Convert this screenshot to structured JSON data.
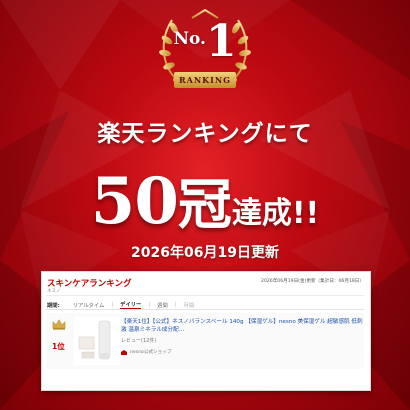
{
  "badge": {
    "no_prefix": "No.",
    "no_number": "1",
    "ribbon": "RANKING"
  },
  "headline": "楽天ランキングにて",
  "achievement": {
    "number": "50",
    "kanji": "冠",
    "suffix": "達成!!"
  },
  "update_date": "2026年06月19日更新",
  "ranking_card": {
    "title": "スキンケアランキング",
    "subtitle": "ネスノ",
    "updated": "2026年06月19日(金)更新（集計日：06月18日）",
    "period_label": "期間:",
    "tabs": [
      "リアルタイム",
      "デイリー",
      "週間",
      "月間"
    ],
    "active_tab": "デイリー",
    "item": {
      "rank": "1位",
      "title": "【楽天1位】【公式】ネスノバランスベール 140g 【保湿ゲル】nesno 美保湿ゲル 超敏感肌 低刺激 温泉ミネラル成分配…",
      "reviews": "レビュー(12件)",
      "shop": "nesno公式ショップ"
    }
  },
  "colors": {
    "background": "#b2030a",
    "accent_red": "#bf0000",
    "gold": "#d9ac4a",
    "link_blue": "#1a4fa8"
  },
  "icons": [
    "laurel-wreath-icon",
    "crown-icon",
    "shop-icon"
  ]
}
